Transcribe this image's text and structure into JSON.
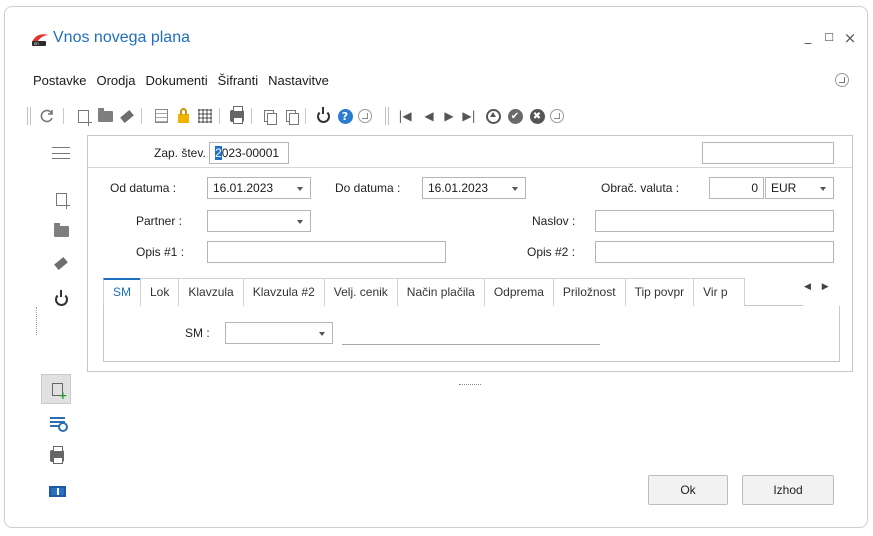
{
  "window": {
    "title": "Vnos novega plana",
    "controls": {
      "minimize_glyph": "_",
      "maximize_glyph": "☐",
      "close_glyph": "×"
    }
  },
  "menu": [
    "Postavke",
    "Orodja",
    "Dokumenti",
    "Šifranti",
    "Nastavitve"
  ],
  "toolbar_icons": [
    "refresh-icon",
    "new-doc-icon",
    "open-folder-icon",
    "eraser-icon",
    "calculator-icon",
    "lock-icon",
    "grid-icon",
    "print-icon",
    "copy-icon",
    "paste-icon",
    "power-icon",
    "help-icon",
    "collapse-icon",
    "first-record-icon",
    "previous-record-icon",
    "next-record-icon",
    "last-record-icon",
    "eject-icon",
    "check-icon",
    "cancel-icon",
    "collapse-icon"
  ],
  "toolbar_glyphs": {
    "first": "|◀",
    "prev": "◀",
    "next": "▶",
    "last": "▶|",
    "check": "✔",
    "cancel": "✖",
    "help": "?"
  },
  "sidebar_icons": [
    "menu-icon",
    "new-doc-icon",
    "folder-icon",
    "eraser-icon",
    "power-icon",
    "new-record-icon",
    "table-search-icon",
    "print-icon",
    "screen-icon"
  ],
  "form": {
    "doc_number_label": "Zap. štev.",
    "doc_number_caret": "2",
    "doc_number_rest": "023-00001",
    "doc_extra_value": "",
    "date_from_label": "Od datuma :",
    "date_from": "16.01.2023",
    "date_to_label": "Do datuma :",
    "date_to": "16.01.2023",
    "currency_label": "Obrač. valuta :",
    "currency_amount": "0",
    "currency_code": "EUR",
    "partner_label": "Partner :",
    "partner_value": "",
    "address_label": "Naslov :",
    "address_value": "",
    "desc1_label": "Opis #1 :",
    "desc1_value": "",
    "desc2_label": "Opis #2 :",
    "desc2_value": ""
  },
  "tabs": [
    "SM",
    "Lok",
    "Klavzula",
    "Klavzula #2",
    "Velj. cenik",
    "Način plačila",
    "Odprema",
    "Priložnost",
    "Tip povpr",
    "Vir p"
  ],
  "tab_scroll_glyphs": "◀ ▶",
  "active_tab": "SM",
  "tab_content": {
    "sm_label": "SM :",
    "sm_value": ""
  },
  "buttons": {
    "ok": "Ok",
    "exit": "Izhod"
  },
  "colors": {
    "accent": "#1f6fbf",
    "help_blue": "#2b7bd1",
    "screen_blue": "#2a6fc4",
    "lock_yellow": "#f0b400",
    "plus_green": "#1f9a2f"
  }
}
